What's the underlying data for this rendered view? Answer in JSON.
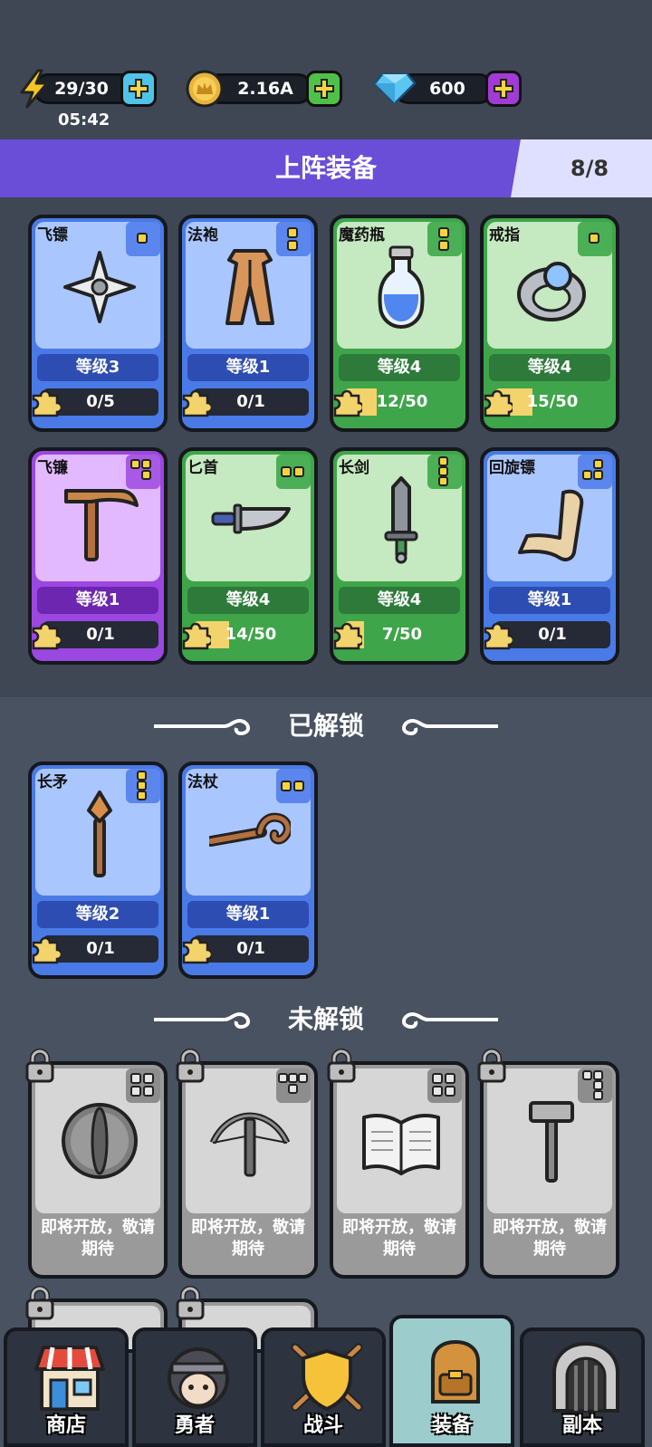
{
  "resources": {
    "energy": "29/30",
    "timer": "05:42",
    "gold": "2.16A",
    "gems": "600"
  },
  "header": {
    "title": "上阵装备",
    "count": "8/8"
  },
  "equipped": [
    {
      "name": "飞镖",
      "level": "等级3",
      "progress": "0/5",
      "fill": 0,
      "rarity": "blue"
    },
    {
      "name": "法袍",
      "level": "等级1",
      "progress": "0/1",
      "fill": 0,
      "rarity": "blue"
    },
    {
      "name": "魔药瓶",
      "level": "等级4",
      "progress": "12/50",
      "fill": 0.24,
      "rarity": "green"
    },
    {
      "name": "戒指",
      "level": "等级4",
      "progress": "15/50",
      "fill": 0.3,
      "rarity": "green"
    },
    {
      "name": "飞镰",
      "level": "等级1",
      "progress": "0/1",
      "fill": 0,
      "rarity": "purple"
    },
    {
      "name": "匕首",
      "level": "等级4",
      "progress": "14/50",
      "fill": 0.28,
      "rarity": "green"
    },
    {
      "name": "长剑",
      "level": "等级4",
      "progress": "7/50",
      "fill": 0.14,
      "rarity": "green"
    },
    {
      "name": "回旋镖",
      "level": "等级1",
      "progress": "0/1",
      "fill": 0,
      "rarity": "blue"
    }
  ],
  "unlocked": {
    "title": "已解锁",
    "items": [
      {
        "name": "长矛",
        "level": "等级2",
        "progress": "0/1",
        "fill": 0,
        "rarity": "blue"
      },
      {
        "name": "法杖",
        "level": "等级1",
        "progress": "0/1",
        "fill": 0,
        "rarity": "blue"
      }
    ]
  },
  "locked": {
    "title": "未解锁",
    "coming_soon": "即将开放，敬请期待"
  },
  "nav": {
    "shop": "商店",
    "hero": "勇者",
    "battle": "战斗",
    "equipment": "装备",
    "dungeon": "副本"
  }
}
